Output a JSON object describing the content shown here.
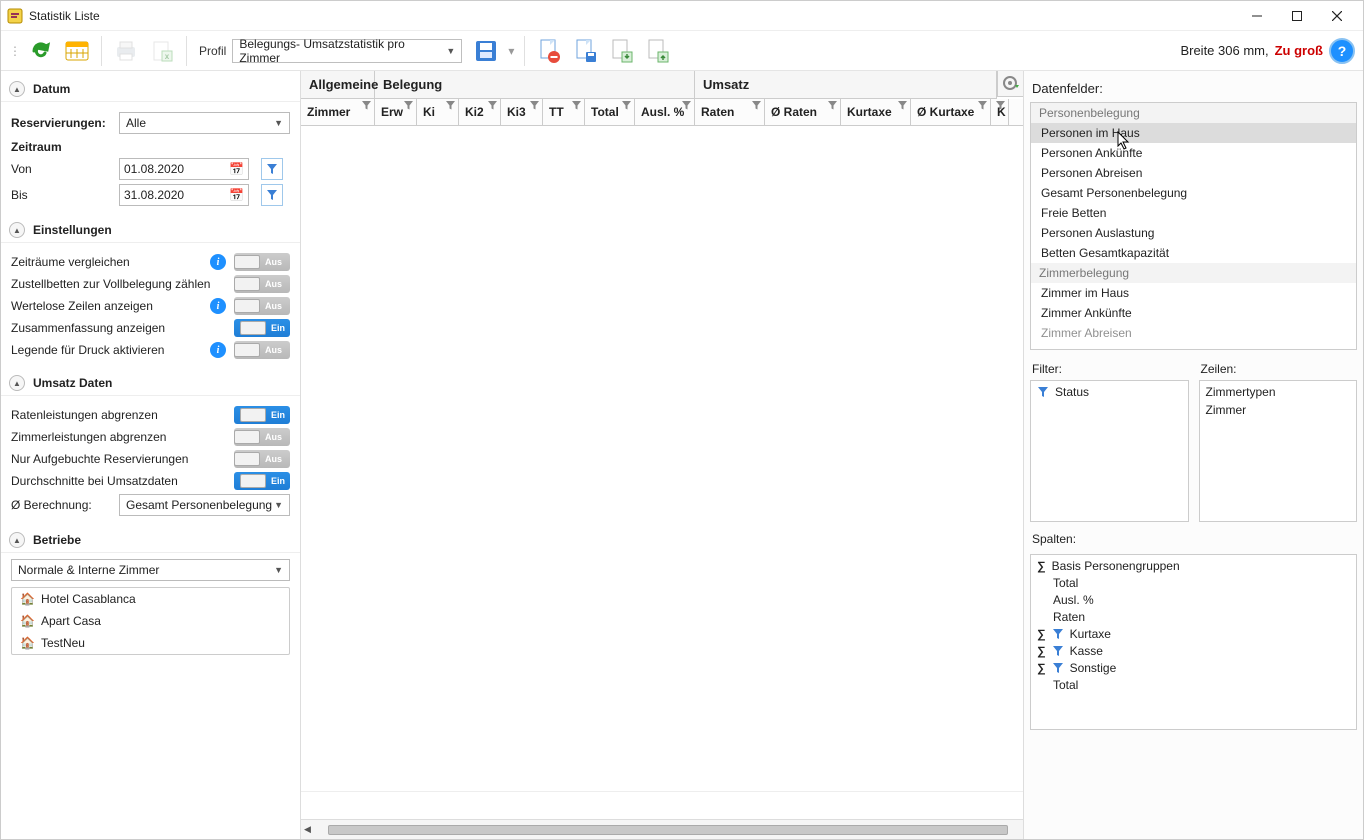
{
  "title": "Statistik Liste",
  "toolbar": {
    "profile_label": "Profil",
    "profile_value": "Belegungs- Umsatzstatistik pro Zimmer",
    "width_label": "Breite 306 mm, ",
    "width_warn": "Zu groß"
  },
  "sections": {
    "datum": "Datum",
    "einstellungen": "Einstellungen",
    "umsatz": "Umsatz Daten",
    "betriebe": "Betriebe"
  },
  "datum": {
    "reserv_label": "Reservierungen:",
    "reserv_value": "Alle",
    "zeitraum_label": "Zeitraum",
    "von_label": "Von",
    "von_value": "01.08.2020",
    "bis_label": "Bis",
    "bis_value": "31.08.2020"
  },
  "settings": {
    "zeitraeume": "Zeiträume vergleichen",
    "zustell": "Zustellbetten zur Vollbelegung zählen",
    "wertlose": "Wertelose Zeilen anzeigen",
    "zusammen": "Zusammenfassung anzeigen",
    "legende": "Legende für Druck aktivieren",
    "aus": "Aus",
    "ein": "Ein"
  },
  "umsatz": {
    "raten": "Ratenleistungen abgrenzen",
    "zimmer": "Zimmerleistungen abgrenzen",
    "nurauf": "Nur Aufgebuchte Reservierungen",
    "durch": "Durchschnitte bei Umsatzdaten",
    "nullber_label": "Ø Berechnung:",
    "nullber_value": "Gesamt Personenbelegung"
  },
  "betriebe": {
    "select_value": "Normale & Interne Zimmer",
    "items": [
      "Hotel Casablanca",
      "Apart Casa",
      "TestNeu"
    ]
  },
  "grid": {
    "groups": {
      "allgemeine": "Allgemeine",
      "belegung": "Belegung",
      "umsatz": "Umsatz"
    },
    "cols": [
      "Zimmer",
      "Erw",
      "Ki",
      "Ki2",
      "Ki3",
      "TT",
      "Total",
      "Ausl. %",
      "Raten",
      "Ø Raten",
      "Kurtaxe",
      "Ø Kurtaxe",
      "K"
    ]
  },
  "right": {
    "datenfelder": "Datenfelder:",
    "sections": {
      "personen": "Personenbelegung",
      "zimmerbel": "Zimmerbelegung"
    },
    "items_personen": [
      "Personen im Haus",
      "Personen Ankünfte",
      "Personen Abreisen",
      "Gesamt Personenbelegung",
      "Freie Betten",
      "Personen Auslastung",
      "Betten Gesamtkapazität"
    ],
    "items_zimmer": [
      "Zimmer im Haus",
      "Zimmer Ankünfte",
      "Zimmer Abreisen"
    ],
    "filter_label": "Filter:",
    "filter_items": [
      "Status"
    ],
    "zeilen_label": "Zeilen:",
    "zeilen_items": [
      "Zimmertypen",
      "Zimmer"
    ],
    "spalten_label": "Spalten:",
    "spalten": [
      {
        "sigma": true,
        "funnel": false,
        "label": "Basis Personengruppen"
      },
      {
        "sigma": false,
        "funnel": false,
        "label": "Total"
      },
      {
        "sigma": false,
        "funnel": false,
        "label": "Ausl. %"
      },
      {
        "sigma": false,
        "funnel": false,
        "label": "Raten"
      },
      {
        "sigma": true,
        "funnel": true,
        "label": "Kurtaxe"
      },
      {
        "sigma": true,
        "funnel": true,
        "label": "Kasse"
      },
      {
        "sigma": true,
        "funnel": true,
        "label": "Sonstige"
      },
      {
        "sigma": false,
        "funnel": false,
        "label": "Total"
      }
    ]
  }
}
